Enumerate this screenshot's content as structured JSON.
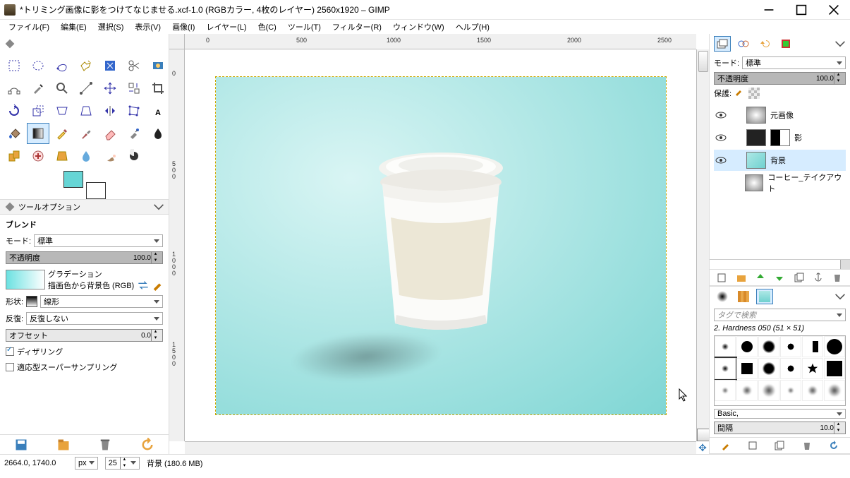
{
  "window": {
    "title": "*トリミング画像に影をつけてなじませる.xcf-1.0 (RGBカラー, 4枚のレイヤー) 2560x1920 – GIMP"
  },
  "menu": {
    "items": [
      "ファイル(F)",
      "編集(E)",
      "選択(S)",
      "表示(V)",
      "画像(I)",
      "レイヤー(L)",
      "色(C)",
      "ツール(T)",
      "フィルター(R)",
      "ウィンドウ(W)",
      "ヘルプ(H)"
    ]
  },
  "toolbox": {
    "tools": [
      "rect-select",
      "ellipse-select",
      "free-select",
      "fuzzy-select",
      "by-color-select",
      "scissors",
      "fg-select",
      "paths",
      "color-picker",
      "zoom",
      "measure",
      "move",
      "align",
      "crop",
      "rotate",
      "scale",
      "shear",
      "perspective",
      "flip",
      "cage",
      "text",
      "bucket-fill",
      "blend",
      "pencil",
      "paintbrush",
      "eraser",
      "airbrush",
      "ink",
      "clone",
      "heal",
      "perspective-clone",
      "blur-sharpen",
      "smudge",
      "dodge-burn"
    ],
    "selected": "blend"
  },
  "tooloptions": {
    "title": "ツールオプション",
    "category": "ブレンド",
    "mode_label": "モード:",
    "mode_value": "標準",
    "opacity_label": "不透明度",
    "opacity_value": "100.0",
    "gradient_label": "グラデーション",
    "gradient_value": "描画色から背景色 (RGB)",
    "shape_label": "形状:",
    "shape_value": "線形",
    "repeat_label": "反復:",
    "repeat_value": "反復しない",
    "offset_label": "オフセット",
    "offset_value": "0.0",
    "dither_label": "ディザリング",
    "supersample_label": "適応型スーパーサンプリング"
  },
  "canvas": {
    "ruler_marks": [
      "0",
      "500",
      "1000",
      "1500",
      "2000",
      "2500"
    ],
    "ruler_v": [
      "0",
      "500",
      "1000",
      "1500"
    ]
  },
  "status": {
    "coords": "2664.0, 1740.0",
    "unit": "px",
    "zoom": "25",
    "layer_info": "背景 (180.6 MB)"
  },
  "right": {
    "mode_label": "モード:",
    "mode_value": "標準",
    "opacity_label": "不透明度",
    "opacity_value": "100.0",
    "lock_label": "保護:",
    "layers": [
      {
        "name": "元画像",
        "visible": true,
        "sel": false,
        "thumb": "fg"
      },
      {
        "name": "影",
        "visible": true,
        "sel": false,
        "thumb": "shadow",
        "mask": true
      },
      {
        "name": "背景",
        "visible": true,
        "sel": true,
        "thumb": "bg"
      },
      {
        "name": "コーヒー_テイクアウト",
        "visible": false,
        "sel": false,
        "thumb": "fg"
      }
    ],
    "brush_search": "タグで検索",
    "brush_current": "2. Hardness 050 (51 × 51)",
    "brush_preset": "Basic,",
    "spacing_label": "間隔",
    "spacing_value": "10.0"
  }
}
